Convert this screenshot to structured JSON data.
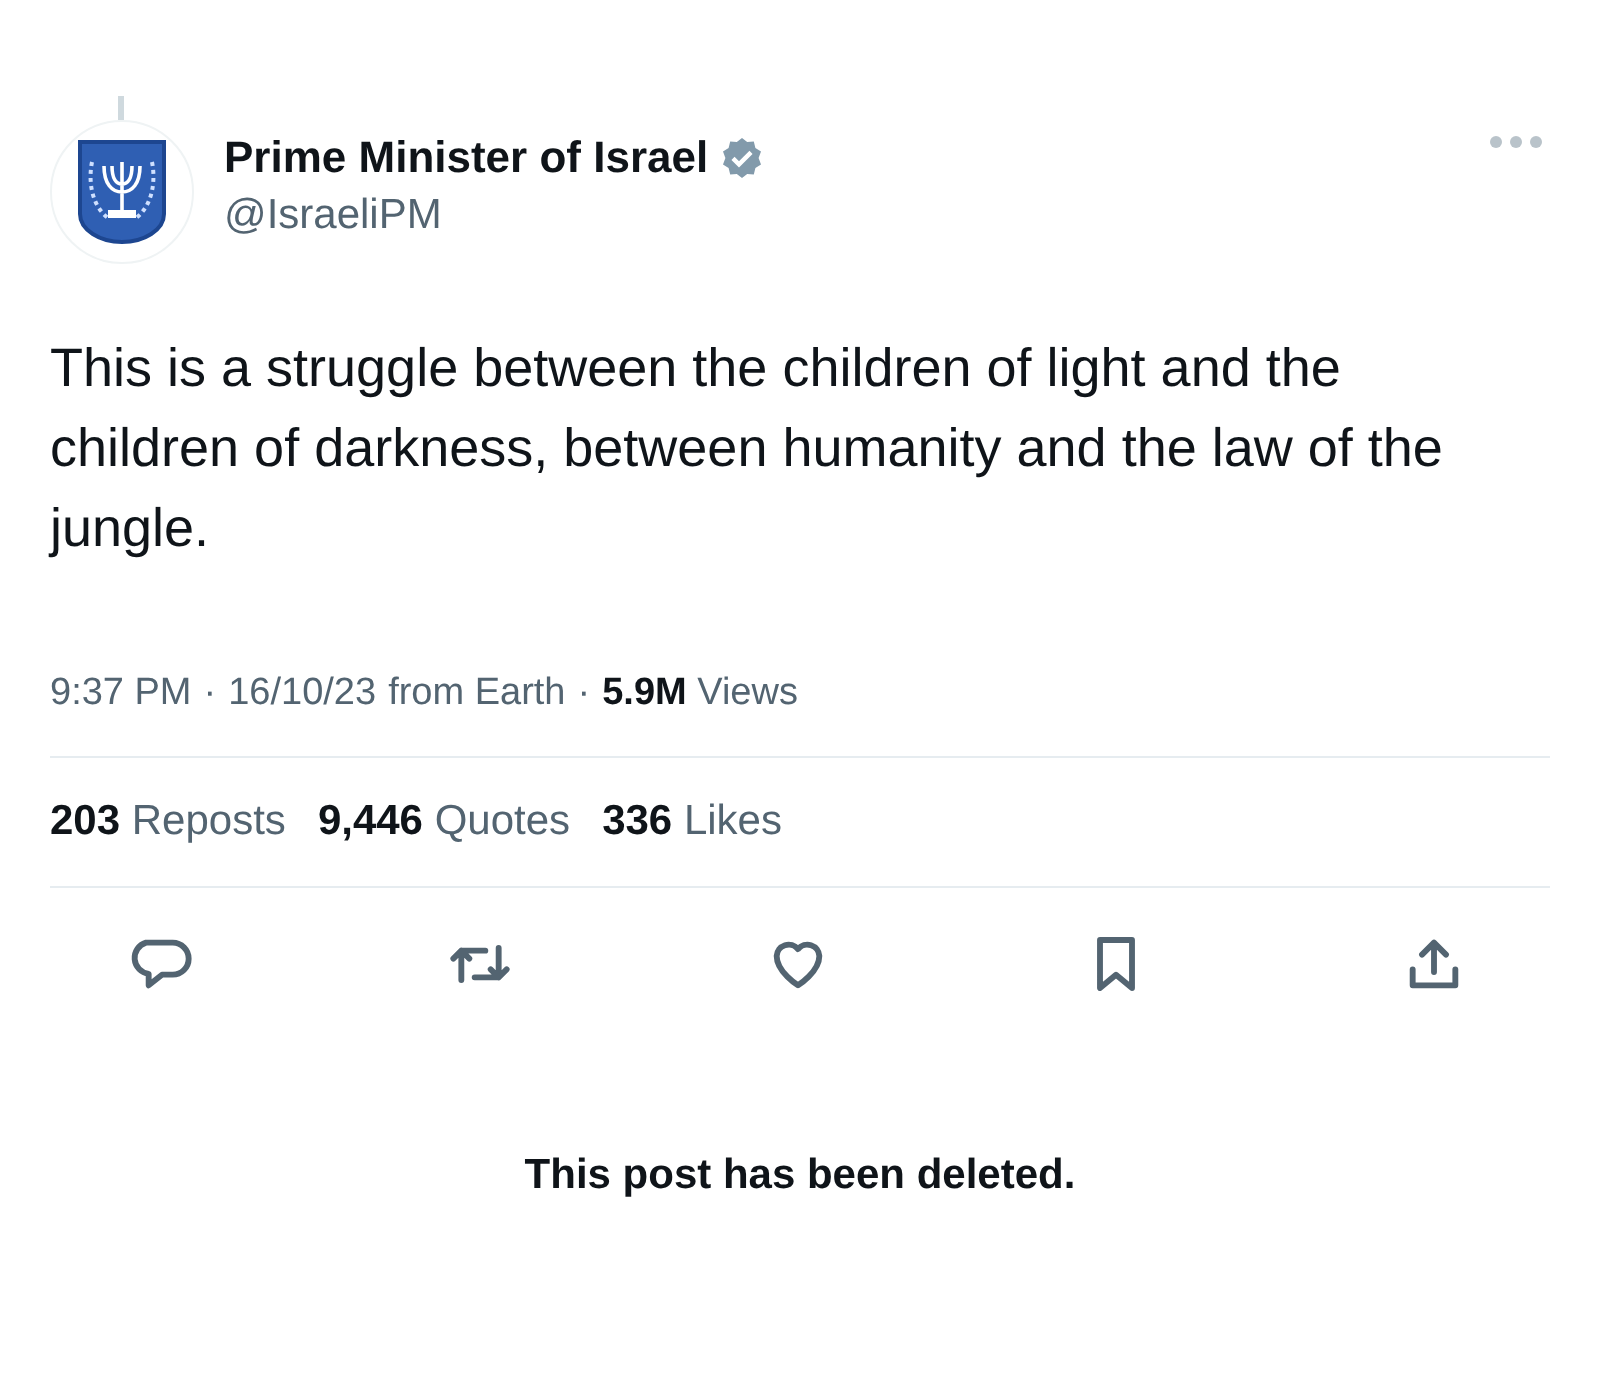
{
  "author": {
    "name": "Prime Minister of Israel",
    "handle": "@IsraeliPM",
    "verified": true
  },
  "post": {
    "text": "This is a struggle between the children of light and the children of darkness, between humanity and the law of the jungle."
  },
  "meta": {
    "separator": "·",
    "time": "9:37 PM",
    "date": "16/10/23",
    "source": "from Earth",
    "views_count": "5.9M",
    "views_label": "Views"
  },
  "stats": [
    {
      "count": "203",
      "label": "Reposts"
    },
    {
      "count": "9,446",
      "label": "Quotes"
    },
    {
      "count": "336",
      "label": "Likes"
    }
  ],
  "actions": [
    {
      "kind": "reply"
    },
    {
      "kind": "repost"
    },
    {
      "kind": "like"
    },
    {
      "kind": "bookmark"
    },
    {
      "kind": "share"
    }
  ],
  "notice": "This post has been deleted."
}
